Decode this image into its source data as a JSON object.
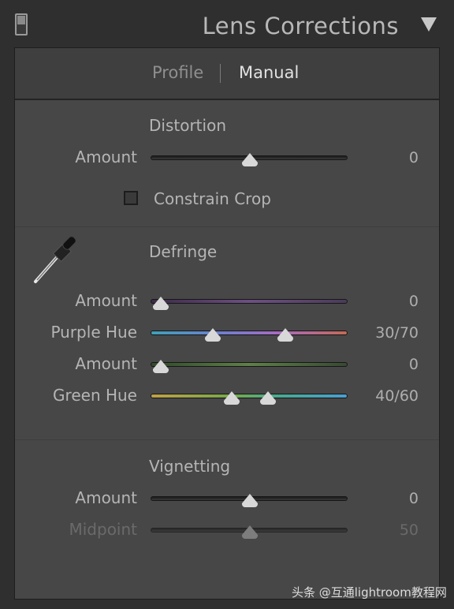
{
  "header": {
    "title": "Lens Corrections"
  },
  "tabs": {
    "profile": "Profile",
    "manual": "Manual"
  },
  "distortion": {
    "title": "Distortion",
    "amount_label": "Amount",
    "amount_value": "0",
    "constrain_crop_label": "Constrain Crop",
    "constrain_crop_checked": false
  },
  "defringe": {
    "title": "Defringe",
    "purple_amount_label": "Amount",
    "purple_amount_value": "0",
    "purple_hue_label": "Purple Hue",
    "purple_hue_value": "30/70",
    "green_amount_label": "Amount",
    "green_amount_value": "0",
    "green_hue_label": "Green Hue",
    "green_hue_value": "40/60"
  },
  "vignetting": {
    "title": "Vignetting",
    "amount_label": "Amount",
    "amount_value": "0",
    "midpoint_label": "Midpoint",
    "midpoint_value": "50"
  },
  "watermark": "头条 @互通lightroom教程网"
}
